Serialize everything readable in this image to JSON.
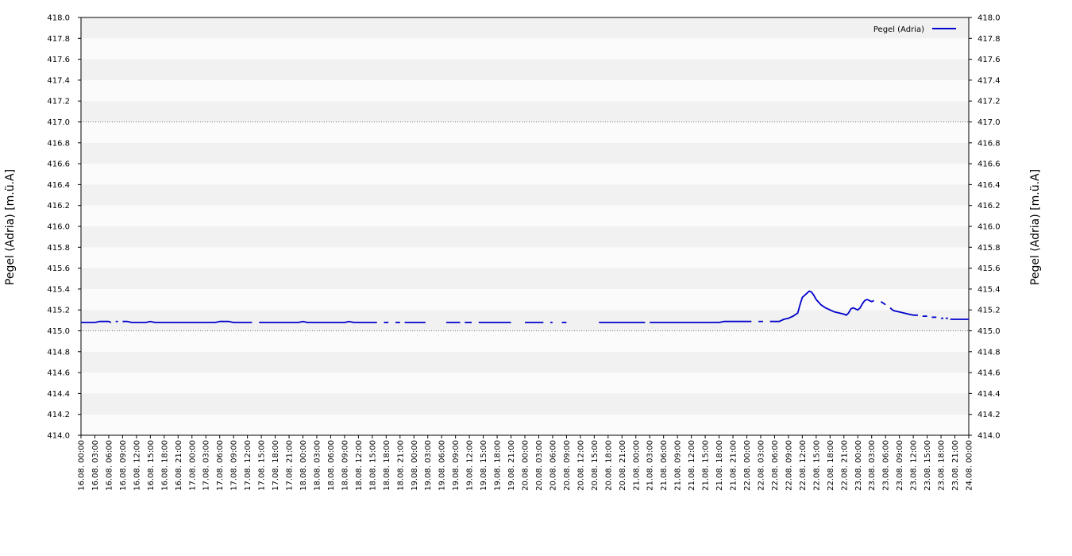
{
  "chart_data": {
    "type": "line",
    "ylabel": "Pegel (Adria) [m.ü.A]",
    "ylabel_right": "Pegel (Adria) [m.ü.A]",
    "ylim": [
      414.0,
      418.0
    ],
    "y_ticks": [
      "414.0",
      "414.2",
      "414.4",
      "414.6",
      "414.8",
      "415.0",
      "415.2",
      "415.4",
      "415.6",
      "415.8",
      "416.0",
      "416.2",
      "416.4",
      "416.6",
      "416.8",
      "417.0",
      "417.2",
      "417.4",
      "417.6",
      "417.8",
      "418.0"
    ],
    "reference_lines": [
      415.0,
      417.0
    ],
    "x_tick_labels": [
      "16.08. 00:00",
      "16.08. 03:00",
      "16.08. 06:00",
      "16.08. 09:00",
      "16.08. 12:00",
      "16.08. 15:00",
      "16.08. 18:00",
      "16.08. 21:00",
      "17.08. 00:00",
      "17.08. 03:00",
      "17.08. 06:00",
      "17.08. 09:00",
      "17.08. 12:00",
      "17.08. 15:00",
      "17.08. 18:00",
      "17.08. 21:00",
      "18.08. 00:00",
      "18.08. 03:00",
      "18.08. 06:00",
      "18.08. 09:00",
      "18.08. 12:00",
      "18.08. 15:00",
      "18.08. 18:00",
      "18.08. 21:00",
      "19.08. 00:00",
      "19.08. 03:00",
      "19.08. 06:00",
      "19.08. 09:00",
      "19.08. 12:00",
      "19.08. 15:00",
      "19.08. 18:00",
      "19.08. 21:00",
      "20.08. 00:00",
      "20.08. 03:00",
      "20.08. 06:00",
      "20.08. 09:00",
      "20.08. 12:00",
      "20.08. 15:00",
      "20.08. 18:00",
      "20.08. 21:00",
      "21.08. 00:00",
      "21.08. 03:00",
      "21.08. 06:00",
      "21.08. 09:00",
      "21.08. 12:00",
      "21.08. 15:00",
      "21.08. 18:00",
      "21.08. 21:00",
      "22.08. 00:00",
      "22.08. 03:00",
      "22.08. 06:00",
      "22.08. 09:00",
      "22.08. 12:00",
      "22.08. 15:00",
      "22.08. 18:00",
      "22.08. 21:00",
      "23.08. 00:00",
      "23.08. 03:00",
      "23.08. 06:00",
      "23.08. 09:00",
      "23.08. 12:00",
      "23.08. 15:00",
      "23.08. 18:00",
      "23.08. 21:00",
      "24.08. 00:00"
    ],
    "x_range_hours": [
      0,
      192
    ],
    "legend": "top-right",
    "series": [
      {
        "name": "Pegel (Adria)",
        "color": "#0000cc",
        "segments": [
          [
            [
              0,
              415.08
            ],
            [
              3,
              415.08
            ],
            [
              4,
              415.09
            ],
            [
              6,
              415.09
            ],
            [
              6.5,
              415.08
            ]
          ],
          [
            [
              7.5,
              415.09
            ],
            [
              8,
              415.09
            ]
          ],
          [
            [
              9,
              415.09
            ],
            [
              10,
              415.09
            ],
            [
              11,
              415.08
            ],
            [
              14,
              415.08
            ],
            [
              15,
              415.09
            ],
            [
              16,
              415.08
            ],
            [
              29,
              415.08
            ],
            [
              30,
              415.09
            ],
            [
              32,
              415.09
            ],
            [
              33,
              415.08
            ],
            [
              37,
              415.08
            ]
          ],
          [
            [
              38.5,
              415.08
            ],
            [
              47,
              415.08
            ],
            [
              48,
              415.09
            ],
            [
              49,
              415.08
            ],
            [
              57,
              415.08
            ],
            [
              58,
              415.09
            ],
            [
              59,
              415.08
            ],
            [
              64,
              415.08
            ]
          ],
          [
            [
              65.5,
              415.08
            ],
            [
              66.5,
              415.08
            ]
          ],
          [
            [
              68,
              415.08
            ],
            [
              69,
              415.08
            ]
          ],
          [
            [
              70,
              415.08
            ],
            [
              74.5,
              415.08
            ]
          ],
          [
            [
              79,
              415.08
            ],
            [
              82,
              415.08
            ]
          ],
          [
            [
              83,
              415.08
            ],
            [
              84.5,
              415.08
            ]
          ],
          [
            [
              86,
              415.08
            ],
            [
              93,
              415.08
            ]
          ],
          [
            [
              96,
              415.08
            ],
            [
              100,
              415.08
            ]
          ],
          [
            [
              101.5,
              415.08
            ],
            [
              102,
              415.08
            ]
          ],
          [
            [
              104,
              415.08
            ],
            [
              105,
              415.08
            ]
          ],
          [
            [
              112,
              415.08
            ],
            [
              122,
              415.08
            ]
          ],
          [
            [
              123,
              415.08
            ],
            [
              138,
              415.08
            ],
            [
              139,
              415.09
            ],
            [
              145,
              415.09
            ]
          ],
          [
            [
              146.5,
              415.09
            ],
            [
              147.5,
              415.09
            ]
          ],
          [
            [
              149,
              415.09
            ],
            [
              151,
              415.09
            ],
            [
              152,
              415.11
            ],
            [
              153,
              415.12
            ],
            [
              154,
              415.14
            ],
            [
              155,
              415.17
            ],
            [
              155.5,
              415.25
            ],
            [
              156,
              415.32
            ],
            [
              157,
              415.36
            ],
            [
              157.5,
              415.38
            ],
            [
              158,
              415.37
            ],
            [
              158.5,
              415.34
            ],
            [
              159,
              415.3
            ],
            [
              160,
              415.25
            ],
            [
              161,
              415.22
            ],
            [
              162,
              415.2
            ],
            [
              163,
              415.18
            ],
            [
              164,
              415.17
            ],
            [
              165,
              415.16
            ],
            [
              165.5,
              415.15
            ],
            [
              166,
              415.17
            ],
            [
              166.5,
              415.21
            ],
            [
              167,
              415.22
            ],
            [
              167.5,
              415.21
            ],
            [
              168,
              415.2
            ],
            [
              168.5,
              415.22
            ],
            [
              169,
              415.26
            ],
            [
              169.5,
              415.29
            ],
            [
              170,
              415.3
            ],
            [
              170.5,
              415.29
            ],
            [
              171,
              415.28
            ],
            [
              171.5,
              415.29
            ]
          ],
          [
            [
              173,
              415.28
            ],
            [
              174,
              415.25
            ]
          ],
          [
            [
              175,
              415.22
            ],
            [
              175.5,
              415.2
            ],
            [
              176,
              415.19
            ],
            [
              177,
              415.18
            ],
            [
              178,
              415.17
            ],
            [
              179,
              415.16
            ],
            [
              180,
              415.15
            ],
            [
              181,
              415.15
            ]
          ],
          [
            [
              182,
              415.14
            ],
            [
              183,
              415.14
            ]
          ],
          [
            [
              184,
              415.13
            ],
            [
              185,
              415.13
            ]
          ],
          [
            [
              186,
              415.12
            ],
            [
              186.5,
              415.12
            ]
          ],
          [
            [
              187,
              415.12
            ],
            [
              187.5,
              415.12
            ]
          ],
          [
            [
              188,
              415.11
            ],
            [
              192,
              415.11
            ]
          ]
        ]
      }
    ]
  }
}
